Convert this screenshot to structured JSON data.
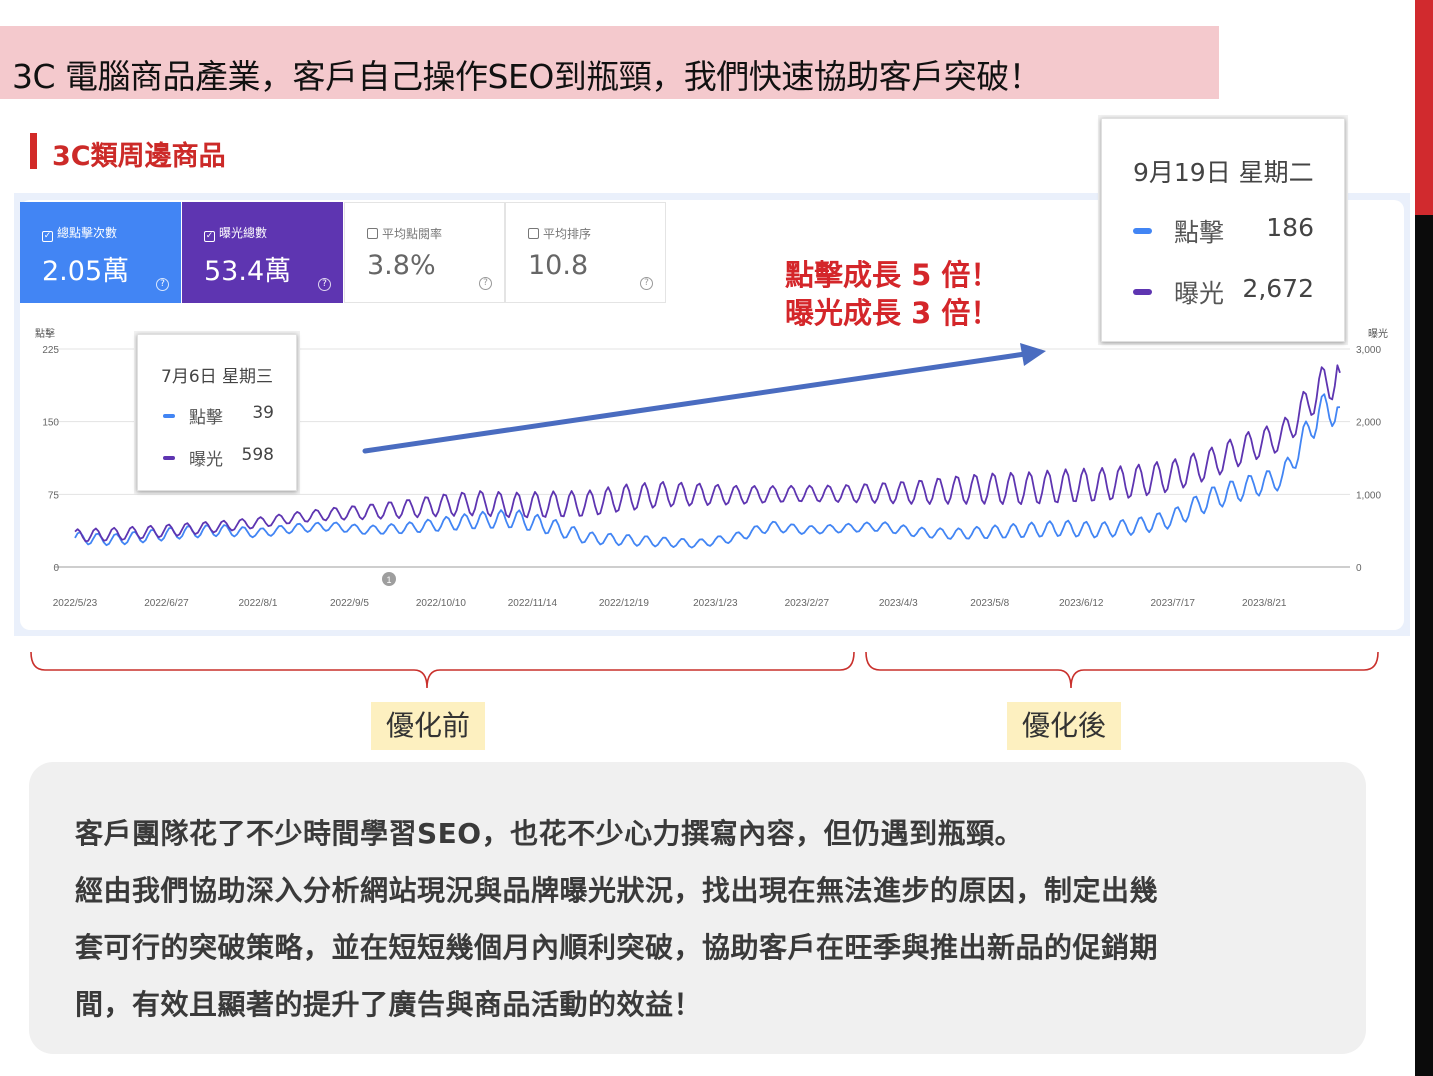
{
  "banner": {
    "title": "3C 電腦商品產業，客戶自己操作SEO到瓶頸，我們快速協助客戶突破！"
  },
  "section": {
    "title": "3C類周邊商品"
  },
  "metrics": [
    {
      "id": "clicks",
      "label": "總點擊次數",
      "value": "2.05萬",
      "checked": true,
      "color": "#4285f4"
    },
    {
      "id": "impressions",
      "label": "曝光總數",
      "value": "53.4萬",
      "checked": true,
      "color": "#5e35b1"
    },
    {
      "id": "ctr",
      "label": "平均點閱率",
      "value": "3.8%",
      "checked": false
    },
    {
      "id": "position",
      "label": "平均排序",
      "value": "10.8",
      "checked": false
    }
  ],
  "growth": {
    "line1": "點擊成長 5 倍！",
    "line2": "曝光成長 3 倍！"
  },
  "tooltips": {
    "before": {
      "date": "7月6日 星期三",
      "clicks_label": "點擊",
      "clicks": "39",
      "impressions_label": "曝光",
      "impressions": "598"
    },
    "after": {
      "date": "9月19日 星期二",
      "clicks_label": "點擊",
      "clicks": "186",
      "impressions_label": "曝光",
      "impressions": "2,672"
    }
  },
  "annotation_marker": "1",
  "phases": {
    "before": "優化前",
    "after": "優化後"
  },
  "description": [
    "客戶團隊花了不少時間學習SEO，也花不少心力撰寫內容，但仍遇到瓶頸。",
    "經由我們協助深入分析網站現況與品牌曝光狀況，找出現在無法進步的原因，制定出幾",
    "套可行的突破策略，並在短短幾個月內順利突破，協助客戶在旺季與推出新品的促銷期",
    "間，有效且顯著的提升了廣告與商品活動的效益！"
  ],
  "colors": {
    "clicks": "#4285f4",
    "impressions": "#5e35b1",
    "accent": "#d4262a",
    "arrow": "#4a6cc0"
  },
  "chart_data": {
    "type": "line",
    "x_ticks": [
      "2022/5/23",
      "2022/6/27",
      "2022/8/1",
      "2022/9/5",
      "2022/10/10",
      "2022/11/14",
      "2022/12/19",
      "2023/1/23",
      "2023/2/27",
      "2023/4/3",
      "2023/5/8",
      "2023/6/12",
      "2023/7/17",
      "2023/8/21"
    ],
    "x_range": [
      "2022/5/23",
      "2023/9/19"
    ],
    "left_axis": {
      "label": "點擊",
      "ticks": [
        "0",
        "75",
        "150",
        "225"
      ],
      "range": [
        0,
        225
      ]
    },
    "right_axis": {
      "label": "曝光",
      "ticks": [
        "0",
        "1,000",
        "2,000",
        "3,000"
      ],
      "range": [
        0,
        3000
      ]
    },
    "series": [
      {
        "name": "點擊",
        "axis": "left",
        "color": "#4285f4",
        "x": [
          "2022/5/23",
          "2022/6/6",
          "2022/6/20",
          "2022/7/4",
          "2022/7/18",
          "2022/8/1",
          "2022/8/15",
          "2022/8/29",
          "2022/9/12",
          "2022/9/26",
          "2022/10/10",
          "2022/10/24",
          "2022/11/7",
          "2022/11/21",
          "2022/12/5",
          "2022/12/19",
          "2023/1/2",
          "2023/1/16",
          "2023/1/30",
          "2023/2/13",
          "2023/2/27",
          "2023/3/13",
          "2023/3/27",
          "2023/4/10",
          "2023/4/24",
          "2023/5/8",
          "2023/5/22",
          "2023/6/5",
          "2023/6/19",
          "2023/7/3",
          "2023/7/17",
          "2023/7/31",
          "2023/8/14",
          "2023/8/28",
          "2023/9/11",
          "2023/9/19"
        ],
        "y": [
          30,
          28,
          32,
          36,
          38,
          35,
          40,
          42,
          38,
          40,
          44,
          48,
          50,
          42,
          30,
          28,
          26,
          24,
          30,
          42,
          38,
          40,
          42,
          36,
          34,
          36,
          38,
          40,
          38,
          42,
          50,
          70,
          82,
          92,
          160,
          165
        ]
      },
      {
        "name": "曝光",
        "axis": "right",
        "color": "#5e35b1",
        "x": [
          "2022/5/23",
          "2022/6/6",
          "2022/6/20",
          "2022/7/4",
          "2022/7/18",
          "2022/8/1",
          "2022/8/15",
          "2022/8/29",
          "2022/9/12",
          "2022/9/26",
          "2022/10/10",
          "2022/10/24",
          "2022/11/7",
          "2022/11/21",
          "2022/12/5",
          "2022/12/19",
          "2023/1/2",
          "2023/1/16",
          "2023/1/30",
          "2023/2/13",
          "2023/2/27",
          "2023/3/13",
          "2023/3/27",
          "2023/4/10",
          "2023/4/24",
          "2023/5/8",
          "2023/5/22",
          "2023/6/5",
          "2023/6/19",
          "2023/7/3",
          "2023/7/17",
          "2023/7/31",
          "2023/8/14",
          "2023/8/28",
          "2023/9/11",
          "2023/9/19"
        ],
        "y": [
          430,
          450,
          480,
          520,
          560,
          610,
          680,
          730,
          760,
          800,
          850,
          880,
          850,
          860,
          870,
          950,
          1000,
          1000,
          990,
          1000,
          1010,
          1010,
          1020,
          1030,
          1060,
          1080,
          1080,
          1110,
          1130,
          1180,
          1260,
          1420,
          1640,
          1800,
          2450,
          2672
        ]
      }
    ]
  }
}
